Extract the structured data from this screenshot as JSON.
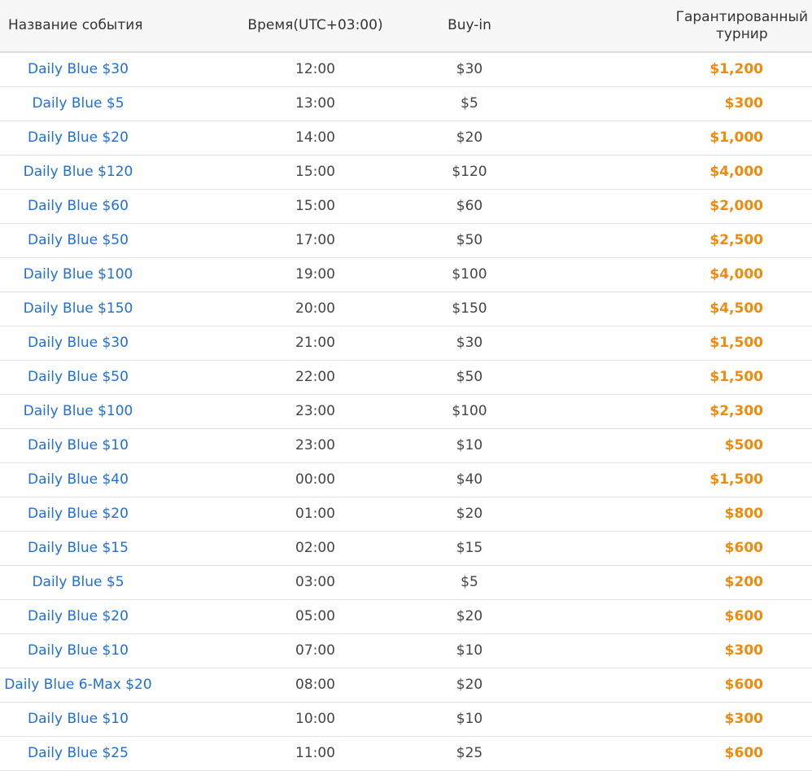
{
  "headers": {
    "name": "Название события",
    "time": "Время(UTC+03:00)",
    "buyin": "Buy-in",
    "guaranteed_line1": "Гарантированный",
    "guaranteed_line2": "турнир"
  },
  "colors": {
    "link": "#1f6fd6",
    "guarantee": "#f08a0c",
    "text": "#444444",
    "header_bg": "#f7f7f7"
  },
  "rows": [
    {
      "name": "Daily Blue $30",
      "time": "12:00",
      "buyin": "$30",
      "guarantee": "$1,200"
    },
    {
      "name": "Daily Blue $5",
      "time": "13:00",
      "buyin": "$5",
      "guarantee": "$300"
    },
    {
      "name": "Daily Blue $20",
      "time": "14:00",
      "buyin": "$20",
      "guarantee": "$1,000"
    },
    {
      "name": "Daily Blue $120",
      "time": "15:00",
      "buyin": "$120",
      "guarantee": "$4,000"
    },
    {
      "name": "Daily Blue $60",
      "time": "15:00",
      "buyin": "$60",
      "guarantee": "$2,000"
    },
    {
      "name": "Daily Blue $50",
      "time": "17:00",
      "buyin": "$50",
      "guarantee": "$2,500"
    },
    {
      "name": "Daily Blue $100",
      "time": "19:00",
      "buyin": "$100",
      "guarantee": "$4,000"
    },
    {
      "name": "Daily Blue $150",
      "time": "20:00",
      "buyin": "$150",
      "guarantee": "$4,500"
    },
    {
      "name": "Daily Blue $30",
      "time": "21:00",
      "buyin": "$30",
      "guarantee": "$1,500"
    },
    {
      "name": "Daily Blue $50",
      "time": "22:00",
      "buyin": "$50",
      "guarantee": "$1,500"
    },
    {
      "name": "Daily Blue $100",
      "time": "23:00",
      "buyin": "$100",
      "guarantee": "$2,300"
    },
    {
      "name": "Daily Blue $10",
      "time": "23:00",
      "buyin": "$10",
      "guarantee": "$500"
    },
    {
      "name": "Daily Blue $40",
      "time": "00:00",
      "buyin": "$40",
      "guarantee": "$1,500"
    },
    {
      "name": "Daily Blue $20",
      "time": "01:00",
      "buyin": "$20",
      "guarantee": "$800"
    },
    {
      "name": "Daily Blue $15",
      "time": "02:00",
      "buyin": "$15",
      "guarantee": "$600"
    },
    {
      "name": "Daily Blue $5",
      "time": "03:00",
      "buyin": "$5",
      "guarantee": "$200"
    },
    {
      "name": "Daily Blue $20",
      "time": "05:00",
      "buyin": "$20",
      "guarantee": "$600"
    },
    {
      "name": "Daily Blue $10",
      "time": "07:00",
      "buyin": "$10",
      "guarantee": "$300"
    },
    {
      "name": "Daily Blue 6-Max $20",
      "time": "08:00",
      "buyin": "$20",
      "guarantee": "$600"
    },
    {
      "name": "Daily Blue $10",
      "time": "10:00",
      "buyin": "$10",
      "guarantee": "$300"
    },
    {
      "name": "Daily Blue $25",
      "time": "11:00",
      "buyin": "$25",
      "guarantee": "$600"
    }
  ]
}
